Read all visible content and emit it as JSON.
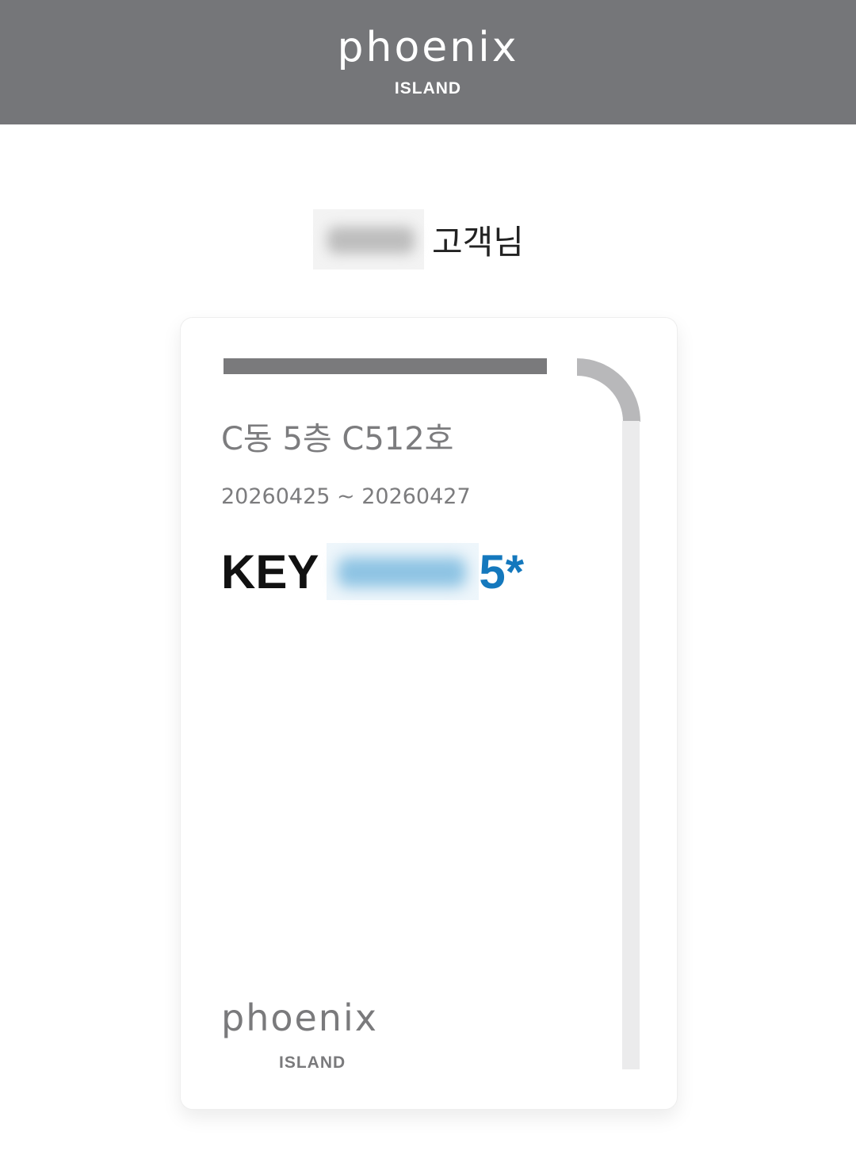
{
  "header": {
    "logo_text": "phoenix",
    "logo_sub": "ISLAND"
  },
  "guest": {
    "title": "고객님"
  },
  "card": {
    "room": "C동 5층 C512호",
    "dates": "20260425 ~ 20260427",
    "key_label": "KEY",
    "key_tail": "5*",
    "logo_text": "phoenix",
    "logo_sub": "ISLAND"
  },
  "colors": {
    "header_bg": "#757679",
    "accent_blue": "#1478bd",
    "card_gray": "#7a7a7c"
  }
}
